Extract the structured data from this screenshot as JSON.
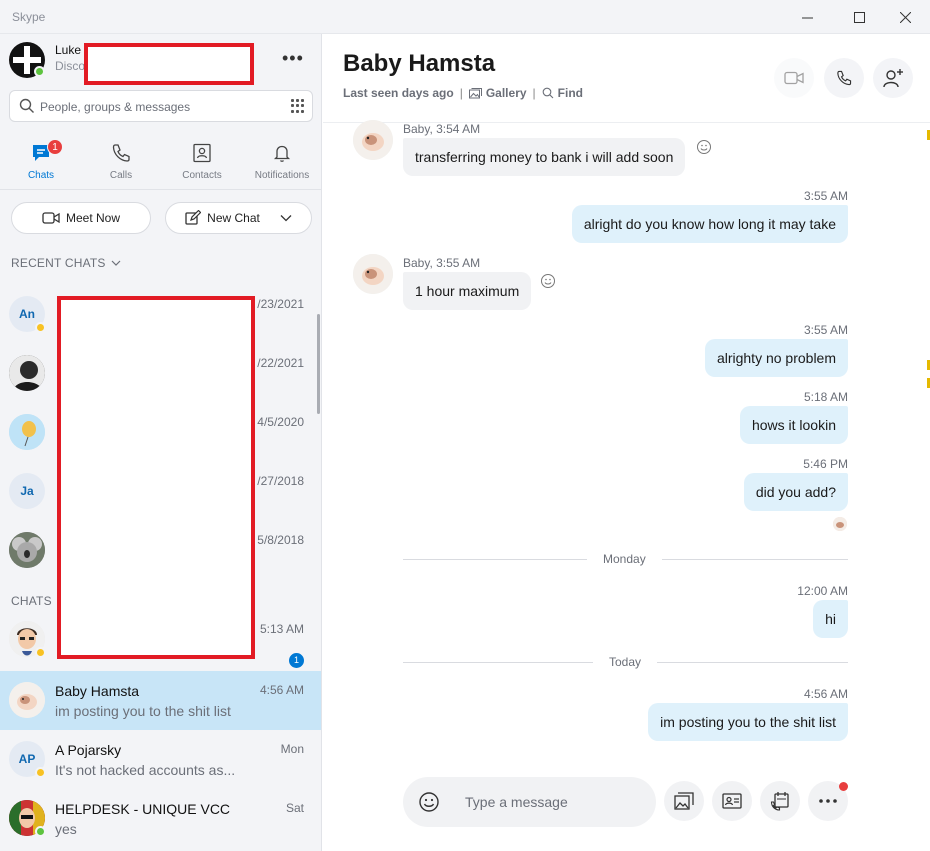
{
  "window": {
    "title": "Skype",
    "controls": [
      "minimize",
      "maximize",
      "close"
    ]
  },
  "colors": {
    "accent": "#0078d4",
    "selected_row": "#c8e5f7",
    "outgoing_bubble": "#dff1fb",
    "incoming_bubble": "#f1f2f4",
    "online": "#5dc33f",
    "away": "#f8c223",
    "badge": "#e83e3e",
    "redaction": "#e21b24"
  },
  "profile": {
    "name": "Luke",
    "status_partial": "Disco",
    "presence": "online"
  },
  "search": {
    "placeholder": "People, groups & messages"
  },
  "nav": {
    "tabs": [
      {
        "label": "Chats",
        "icon": "chat-icon",
        "active": true,
        "badge": "1"
      },
      {
        "label": "Calls",
        "icon": "phone-icon",
        "active": false
      },
      {
        "label": "Contacts",
        "icon": "contacts-icon",
        "active": false
      },
      {
        "label": "Notifications",
        "icon": "bell-icon",
        "active": false
      }
    ]
  },
  "actions": {
    "meet_now": "Meet Now",
    "new_chat": "New Chat"
  },
  "recent": {
    "label": "RECENT CHATS",
    "items": [
      {
        "initials": "An",
        "date_partial": "/23/2021",
        "presence": "away"
      },
      {
        "initials": "",
        "date_partial": "/22/2021",
        "presence": ""
      },
      {
        "initials": "",
        "date_partial": "4/5/2020",
        "presence": ""
      },
      {
        "initials": "Ja",
        "date_partial": "/27/2018",
        "presence": ""
      },
      {
        "initials": "",
        "date_partial": "5/8/2018",
        "presence": ""
      }
    ]
  },
  "chats": {
    "label": "CHATS",
    "first": {
      "time": "5:13 AM",
      "unread": "1",
      "presence": "away"
    },
    "items": [
      {
        "name": "Baby Hamsta",
        "time": "4:56 AM",
        "preview": "im posting you to the shit list",
        "selected": true
      },
      {
        "name": "A Pojarsky",
        "initials": "AP",
        "time": "Mon",
        "preview": "It's not hacked accounts as...",
        "presence": "away"
      },
      {
        "name": "HELPDESK - UNIQUE VCC",
        "time": "Sat",
        "preview": "yes",
        "presence": "online"
      }
    ]
  },
  "conversation": {
    "title": "Baby Hamsta",
    "last_seen": "Last seen days ago",
    "gallery": "Gallery",
    "find": "Find"
  },
  "messages": [
    {
      "dir": "in",
      "meta": "Baby, 3:54 AM",
      "text": "transferring money to bank i will add soon"
    },
    {
      "dir": "out",
      "meta": "3:55 AM",
      "text": "alright do you know how long it may take"
    },
    {
      "dir": "in",
      "meta": "Baby, 3:55 AM",
      "text": "1 hour maximum"
    },
    {
      "dir": "out",
      "meta": "3:55 AM",
      "text": "alrighty no problem"
    },
    {
      "dir": "out",
      "meta": "5:18 AM",
      "text": "hows it lookin"
    },
    {
      "dir": "out",
      "meta": "5:46 PM",
      "text": "did you add?"
    },
    {
      "dir": "out",
      "meta": "12:00 AM",
      "text": "hi"
    },
    {
      "dir": "out",
      "meta": "4:56 AM",
      "text": "im posting you to the shit list"
    }
  ],
  "day_dividers": [
    "Monday",
    "Today"
  ],
  "composer": {
    "placeholder": "Type a message"
  }
}
